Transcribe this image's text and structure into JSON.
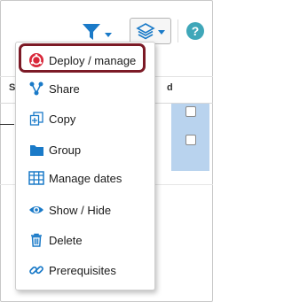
{
  "colors": {
    "icon_blue": "#1a7ac8",
    "highlight": "#7c1a26",
    "help": "#3fa7b9",
    "selected_column": "#b9d3ee"
  },
  "toolbar": {
    "filter_icon": "funnel-icon",
    "layers_icon": "layers-icon",
    "help_label": "?"
  },
  "table": {
    "left_header": "S",
    "right_header": "d"
  },
  "menu": {
    "items": [
      {
        "label": "Deploy / manage",
        "icon": "deploy-icon"
      },
      {
        "label": "Share",
        "icon": "share-icon"
      },
      {
        "label": "Copy",
        "icon": "copy-icon"
      },
      {
        "label": "Group",
        "icon": "folder-icon"
      },
      {
        "label": "Manage dates",
        "icon": "calendar-grid-icon"
      },
      {
        "label": "Show / Hide",
        "icon": "eye-icon"
      },
      {
        "label": "Delete",
        "icon": "trash-icon"
      },
      {
        "label": "Prerequisites",
        "icon": "link-icon"
      }
    ]
  }
}
